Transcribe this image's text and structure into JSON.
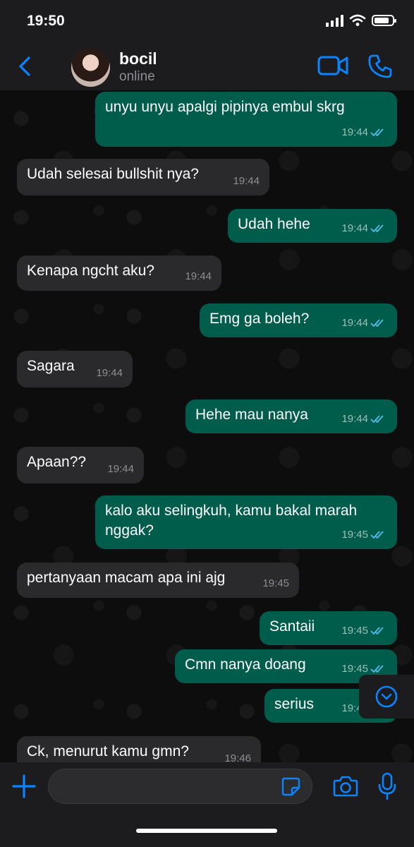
{
  "status_bar": {
    "time": "19:50"
  },
  "header": {
    "contact_name": "bocil",
    "contact_status": "online"
  },
  "messages": [
    {
      "direction": "out",
      "text": "unyu unyu apalgi pipinya embul skrg",
      "time": "19:44",
      "read": true
    },
    {
      "direction": "in",
      "text": "Udah selesai bullshit nya?",
      "time": "19:44"
    },
    {
      "direction": "out",
      "text": "Udah hehe",
      "time": "19:44",
      "read": true
    },
    {
      "direction": "in",
      "text": "Kenapa ngcht aku?",
      "time": "19:44"
    },
    {
      "direction": "out",
      "text": "Emg ga boleh?",
      "time": "19:44",
      "read": true
    },
    {
      "direction": "in",
      "text": "Sagara",
      "time": "19:44"
    },
    {
      "direction": "out",
      "text": "Hehe mau nanya",
      "time": "19:44",
      "read": true
    },
    {
      "direction": "in",
      "text": "Apaan??",
      "time": "19:44"
    },
    {
      "direction": "out",
      "text": "kalo aku selingkuh, kamu bakal marah\nnggak?",
      "time": "19:45",
      "read": true
    },
    {
      "direction": "in",
      "text": "pertanyaan macam apa ini ajg",
      "time": "19:45"
    },
    {
      "direction": "out",
      "text": "Santaii",
      "time": "19:45",
      "read": true
    },
    {
      "direction": "out",
      "text": "Cmn nanya doang",
      "time": "19:45",
      "read": true
    },
    {
      "direction": "out",
      "text": "serius",
      "time": "19:45",
      "read": true
    },
    {
      "direction": "in",
      "text": "Ck, menurut kamu gmn?",
      "time": "19:46"
    }
  ],
  "colors": {
    "accent": "#0a84ff",
    "outgoing_bubble": "#005c4b",
    "incoming_bubble": "#2a2a2c",
    "read_ticks": "#53bdeb"
  },
  "icons": {
    "back": "chevron-left-icon",
    "video": "video-camera-icon",
    "call": "phone-icon",
    "scroll_down": "chevron-down-circle-icon",
    "attach": "plus-icon",
    "sticker": "sticker-icon",
    "camera": "camera-icon",
    "mic": "microphone-icon"
  }
}
